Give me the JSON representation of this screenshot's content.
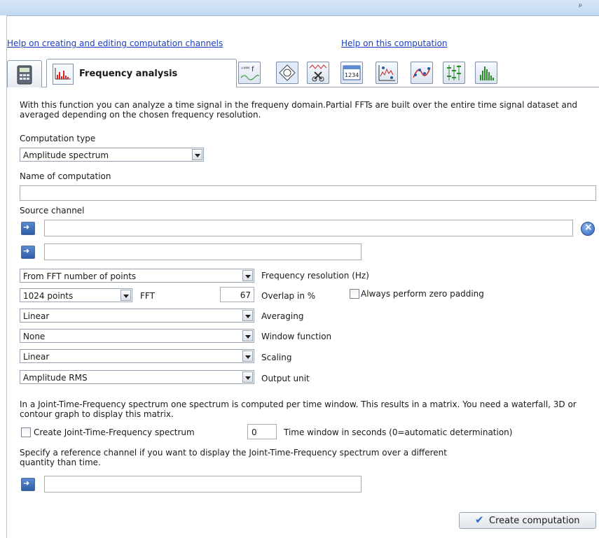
{
  "window": {
    "value": "None",
    "label": "Window function"
  },
  "links": {
    "help_channels": "Help on creating and editing computation channels",
    "help_computation": "Help on this computation"
  },
  "tabs": {
    "active_label": "Frequency analysis",
    "icons": [
      "calculator-icon",
      "frequency-analysis-icon",
      "filter-fg-icon",
      "diamond-icon",
      "cut-signal-icon",
      "number-1234-icon",
      "scatter-icon",
      "curve-fit-icon",
      "statistics-icon",
      "histogram-icon"
    ]
  },
  "description": "With this function you can analyze a time signal in the frequeny domain.Partial FFTs are built over the entire time signal dataset and averaged depending on the chosen frequency resolution.",
  "computation_type": {
    "label": "Computation type",
    "value": "Amplitude spectrum"
  },
  "name": {
    "label": "Name of computation",
    "value": ""
  },
  "source": {
    "label": "Source channel"
  },
  "freq_resolution": {
    "value": "From FFT number of points",
    "label": "Frequency resolution (Hz)"
  },
  "fft": {
    "value": "1024 points",
    "label": "FFT",
    "overlap_value": "67",
    "overlap_label": "Overlap in %",
    "zero_padding_label": "Always perform zero padding"
  },
  "averaging": {
    "value": "Linear",
    "label": "Averaging"
  },
  "scaling": {
    "value": "Linear",
    "label": "Scaling"
  },
  "output_unit": {
    "value": "Amplitude RMS",
    "label": "Output unit"
  },
  "jtf": {
    "description": "In a Joint-Time-Frequency spectrum one spectrum is computed per time window. This results in a matrix. You need a waterfall, 3D or contour graph to display this matrix.",
    "checkbox_label": "Create Joint-Time-Frequency spectrum",
    "time_window_value": "0",
    "time_window_label": "Time window in seconds (0=automatic determination)"
  },
  "reference": {
    "description": "Specify a reference channel if you want to display the Joint-Time-Frequency spectrum over a different quantity than time."
  },
  "create_button": "Create computation",
  "colors": {
    "title_bar": "#c9dcf2",
    "link": "#1a3dbd",
    "accent": "#2e5ca8"
  }
}
